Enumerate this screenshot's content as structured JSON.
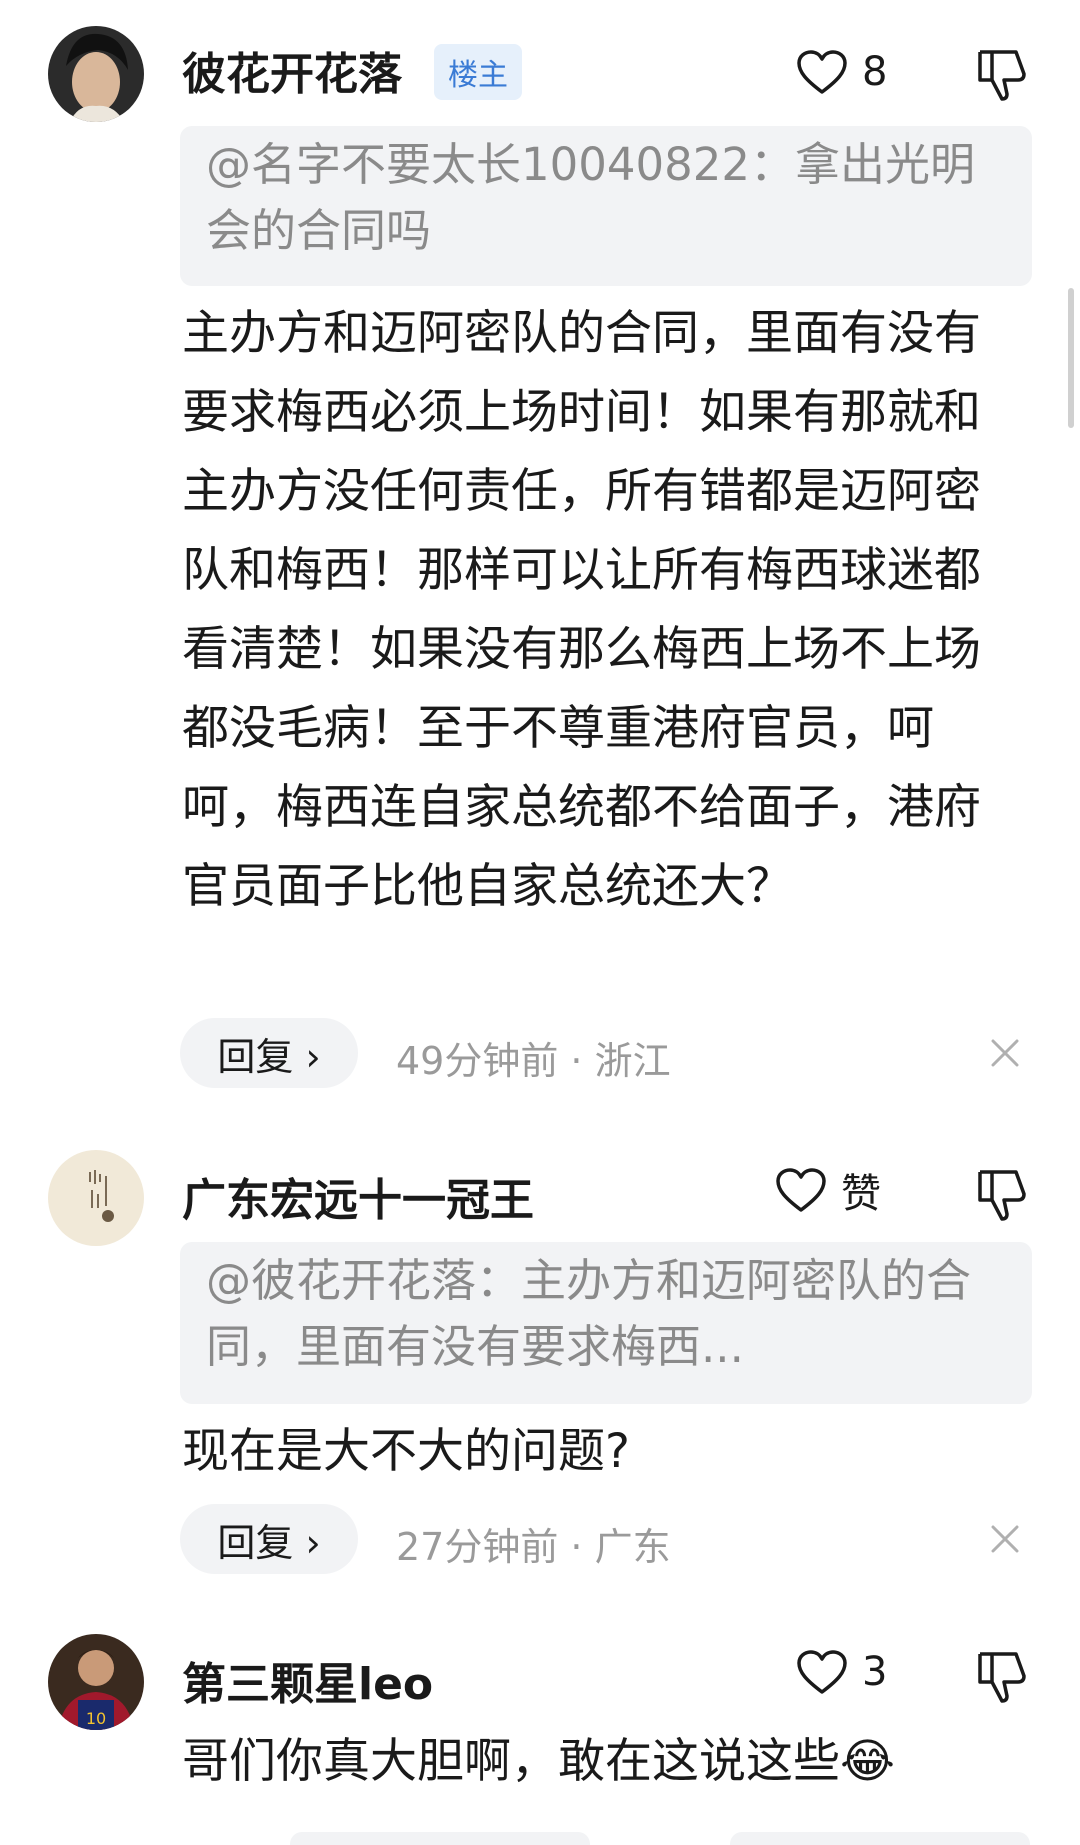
{
  "comments": [
    {
      "username": "彼花开花落",
      "badge": "楼主",
      "likes": "8",
      "quote": "@名字不要太长10040822：拿出光明会的合同吗",
      "body": "主办方和迈阿密队的合同，里面有没有要求梅西必须上场时间！如果有那就和主办方没任何责任，所有错都是迈阿密队和梅西！那样可以让所有梅西球迷都看清楚！如果没有那么梅西上场不上场都没毛病！至于不尊重港府官员，呵呵，梅西连自家总统都不给面子，港府官员面子比他自家总统还大？",
      "reply_label": "回复 ›",
      "meta": "49分钟前 · 浙江"
    },
    {
      "username": "广东宏远十一冠王",
      "likes": "赞",
      "quote": "@彼花开花落：主办方和迈阿密队的合同，里面有没有要求梅西...",
      "body": "现在是大不大的问题?",
      "reply_label": "回复 ›",
      "meta": "27分钟前 · 广东"
    },
    {
      "username": "第三颗星leo",
      "likes": "3",
      "body": "哥们你真大胆啊，敢在这说这些",
      "emoji": "😂"
    }
  ],
  "colors": {
    "badge_text": "#3a7bd5",
    "badge_bg": "#e6f0fb",
    "quote_bg": "#f2f3f5",
    "meta_text": "#9a9a9a"
  },
  "icons": [
    "heart-icon",
    "thumbs-down-icon",
    "close-icon",
    "chevron-right-icon"
  ]
}
